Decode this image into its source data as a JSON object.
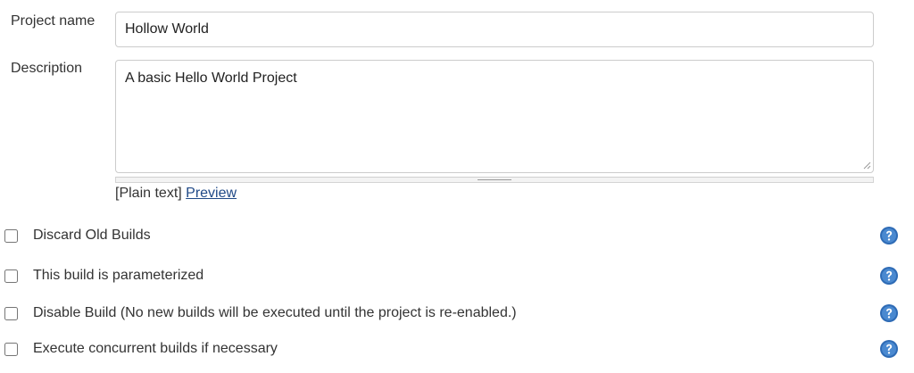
{
  "form": {
    "project_name": {
      "label": "Project name",
      "value": "Hollow World"
    },
    "description": {
      "label": "Description",
      "value": "A basic Hello World Project",
      "markup_prefix": "[Plain text]",
      "preview_link": "Preview"
    }
  },
  "options": [
    {
      "label": "Discard Old Builds",
      "checked": false,
      "help_icon": "help-icon"
    },
    {
      "label": "This build is parameterized",
      "checked": false,
      "help_icon": "help-icon"
    },
    {
      "label": "Disable Build (No new builds will be executed until the project is re-enabled.)",
      "checked": false,
      "help_icon": "help-icon"
    },
    {
      "label": "Execute concurrent builds if necessary",
      "checked": false,
      "help_icon": "help-icon"
    }
  ],
  "colors": {
    "link": "#204a87",
    "help_icon": "#2e6bb5",
    "text": "#333333",
    "border": "#cccccc"
  }
}
